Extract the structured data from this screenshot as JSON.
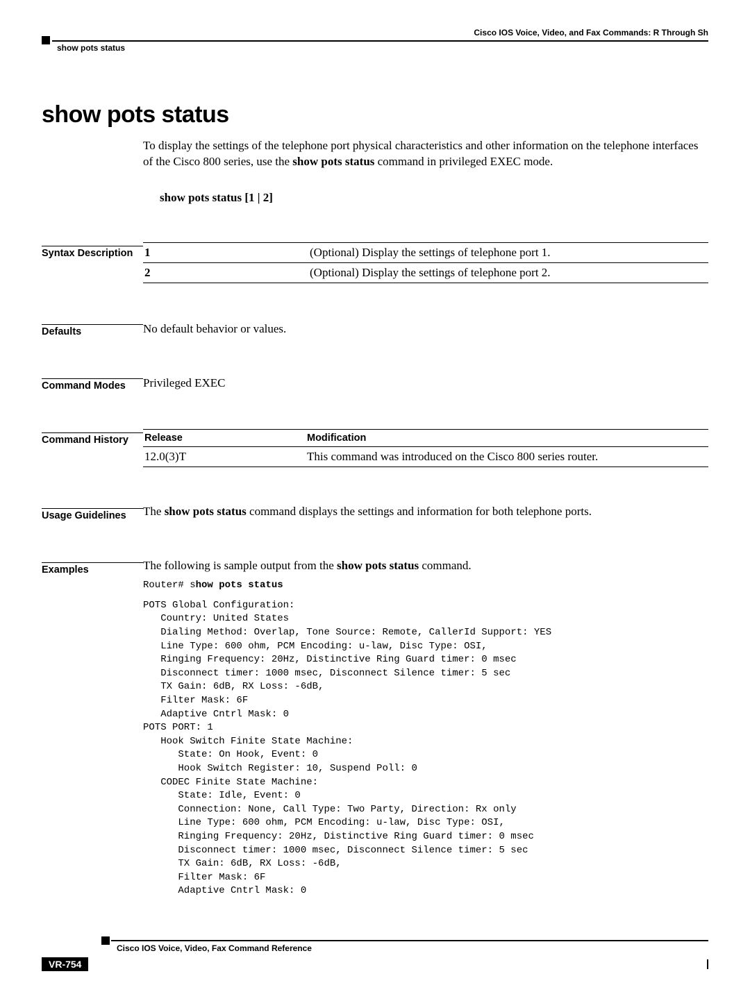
{
  "header": {
    "chapter": "Cisco IOS Voice, Video, and Fax Commands: R Through Sh",
    "running_head": "show pots status"
  },
  "title": "show pots status",
  "intro": {
    "pre": "To display the settings of the telephone port physical characteristics and other information on the telephone interfaces of the Cisco 800 series, use the ",
    "cmd": "show pots status",
    "post": " command in privileged EXEC mode."
  },
  "syntax_line": "show pots status [1 | 2]",
  "sections": {
    "syntax_desc_label": "Syntax Description",
    "defaults_label": "Defaults",
    "modes_label": "Command Modes",
    "history_label": "Command History",
    "usage_label": "Usage Guidelines",
    "examples_label": "Examples"
  },
  "syntax_rows": [
    {
      "arg": "1",
      "desc": "(Optional) Display the settings of telephone port 1."
    },
    {
      "arg": "2",
      "desc": "(Optional) Display the settings of telephone port 2."
    }
  ],
  "defaults_text": "No default behavior or values.",
  "modes_text": "Privileged EXEC",
  "history": {
    "h1": "Release",
    "h2": "Modification",
    "rows": [
      {
        "rel": "12.0(3)T",
        "mod": "This command was introduced on the Cisco 800 series router."
      }
    ]
  },
  "usage": {
    "pre": "The ",
    "cmd": "show pots status",
    "post": " command displays the settings and information for both telephone ports."
  },
  "examples": {
    "intro_pre": "The following is sample output from the ",
    "intro_cmd": "show pots status",
    "intro_post": " command.",
    "prompt": "Router# ",
    "prompt_s": "s",
    "prompt_cmd": "how pots status",
    "output": "POTS Global Configuration:\n   Country: United States\n   Dialing Method: Overlap, Tone Source: Remote, CallerId Support: YES\n   Line Type: 600 ohm, PCM Encoding: u-law, Disc Type: OSI,\n   Ringing Frequency: 20Hz, Distinctive Ring Guard timer: 0 msec\n   Disconnect timer: 1000 msec, Disconnect Silence timer: 5 sec\n   TX Gain: 6dB, RX Loss: -6dB,\n   Filter Mask: 6F\n   Adaptive Cntrl Mask: 0\nPOTS PORT: 1\n   Hook Switch Finite State Machine:\n      State: On Hook, Event: 0\n      Hook Switch Register: 10, Suspend Poll: 0\n   CODEC Finite State Machine:\n      State: Idle, Event: 0\n      Connection: None, Call Type: Two Party, Direction: Rx only\n      Line Type: 600 ohm, PCM Encoding: u-law, Disc Type: OSI,\n      Ringing Frequency: 20Hz, Distinctive Ring Guard timer: 0 msec\n      Disconnect timer: 1000 msec, Disconnect Silence timer: 5 sec\n      TX Gain: 6dB, RX Loss: -6dB,\n      Filter Mask: 6F\n      Adaptive Cntrl Mask: 0"
  },
  "footer": {
    "book": "Cisco IOS Voice, Video, Fax Command Reference",
    "page": "VR-754"
  }
}
